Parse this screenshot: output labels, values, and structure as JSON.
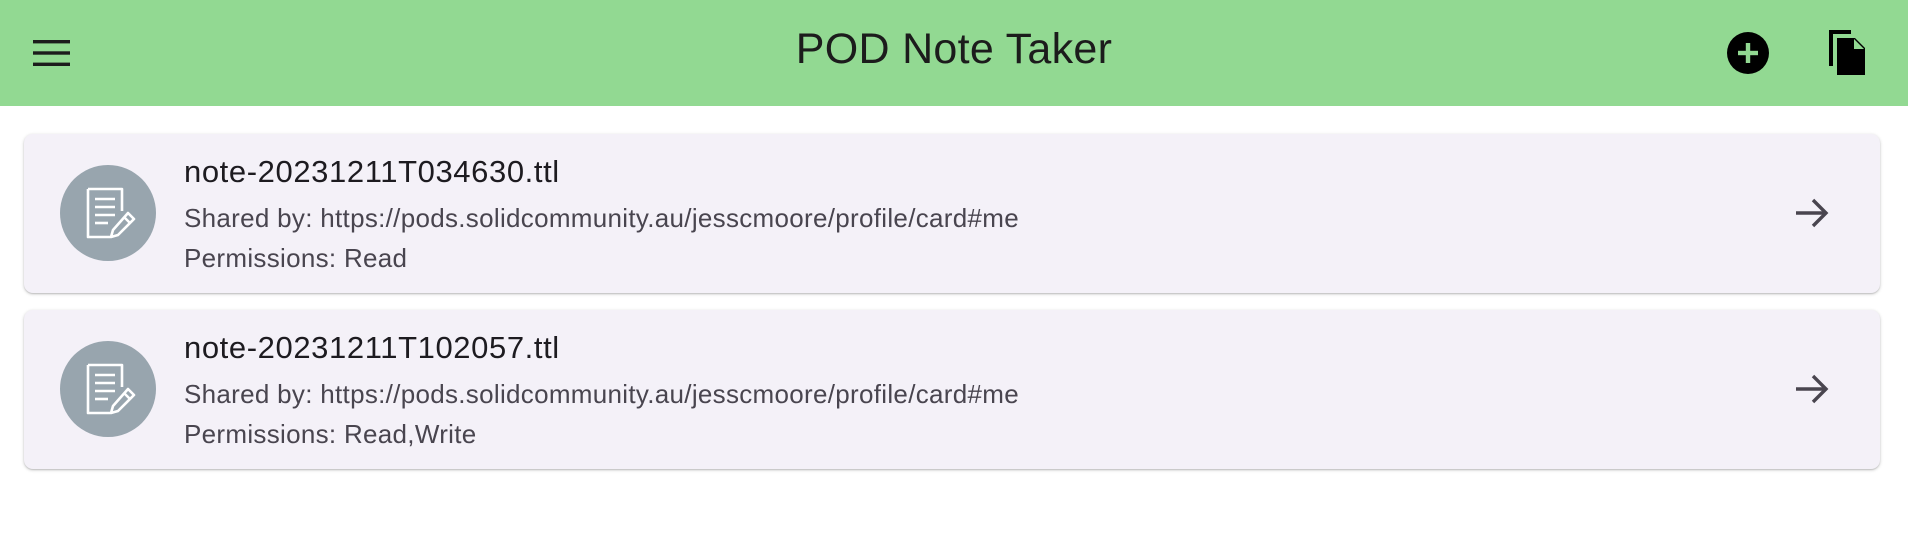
{
  "app_bar": {
    "title": "POD Note Taker",
    "background": "#92d992",
    "icons": {
      "menu": "menu-icon",
      "add": "add-circle-icon",
      "copy": "copy-file-icon"
    }
  },
  "notes": [
    {
      "title": "note-20231211T034630.ttl",
      "shared_by": "Shared by: https://pods.solidcommunity.au/jesscmoore/profile/card#me",
      "permissions": "Permissions: Read",
      "icon": "note-edit-icon",
      "trailing_icon": "arrow-forward-icon"
    },
    {
      "title": "note-20231211T102057.ttl",
      "shared_by": "Shared by: https://pods.solidcommunity.au/jesscmoore/profile/card#me",
      "permissions": "Permissions: Read,Write",
      "icon": "note-edit-icon",
      "trailing_icon": "arrow-forward-icon"
    }
  ],
  "colors": {
    "card_background": "#f4f1f8",
    "avatar_background": "#98a5ae",
    "title_text": "#1d1b20",
    "secondary_text": "#49454f"
  }
}
